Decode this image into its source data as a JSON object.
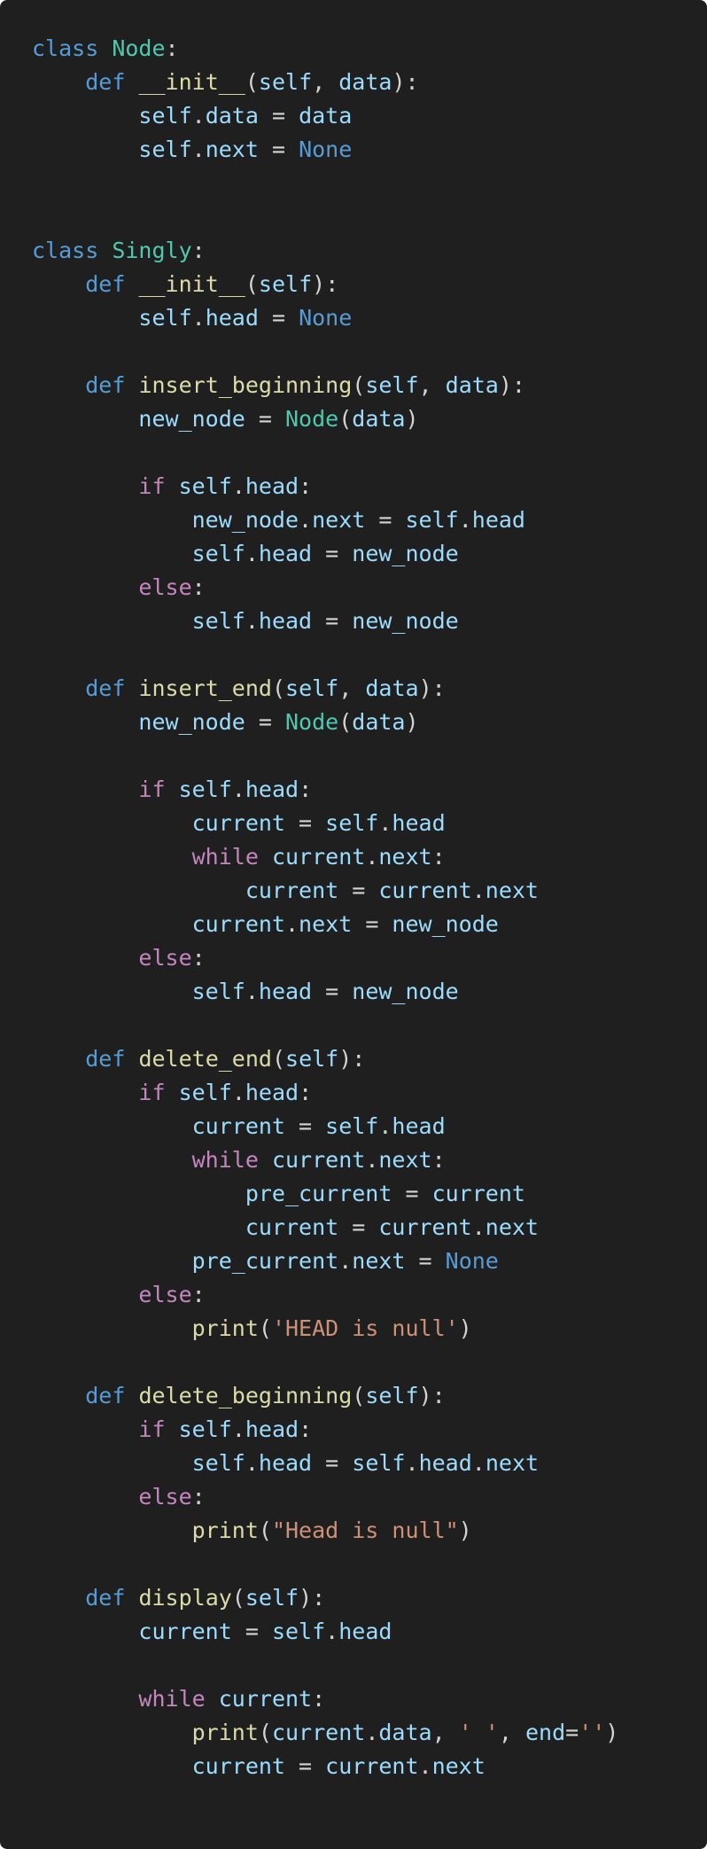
{
  "colors": {
    "background": "#1f1f1f",
    "keyword": "#569cd6",
    "control": "#c586c0",
    "class": "#4ec9b0",
    "function": "#dcdcaa",
    "variable": "#9cdcfe",
    "constant": "#569cd6",
    "string": "#ce9178",
    "punctuation": "#d4d4d4"
  },
  "code": {
    "language": "python",
    "lines": [
      [
        {
          "t": "class",
          "k": "keyword"
        },
        {
          "t": " ",
          "k": "punct"
        },
        {
          "t": "Node",
          "k": "class"
        },
        {
          "t": ":",
          "k": "punct"
        }
      ],
      [
        {
          "t": "    ",
          "k": "punct"
        },
        {
          "t": "def",
          "k": "keyword"
        },
        {
          "t": " ",
          "k": "punct"
        },
        {
          "t": "__init__",
          "k": "func"
        },
        {
          "t": "(",
          "k": "punct"
        },
        {
          "t": "self",
          "k": "var"
        },
        {
          "t": ", ",
          "k": "punct"
        },
        {
          "t": "data",
          "k": "var"
        },
        {
          "t": "):",
          "k": "punct"
        }
      ],
      [
        {
          "t": "        ",
          "k": "punct"
        },
        {
          "t": "self",
          "k": "var"
        },
        {
          "t": ".",
          "k": "punct"
        },
        {
          "t": "data",
          "k": "var"
        },
        {
          "t": " = ",
          "k": "punct"
        },
        {
          "t": "data",
          "k": "var"
        }
      ],
      [
        {
          "t": "        ",
          "k": "punct"
        },
        {
          "t": "self",
          "k": "var"
        },
        {
          "t": ".",
          "k": "punct"
        },
        {
          "t": "next",
          "k": "var"
        },
        {
          "t": " = ",
          "k": "punct"
        },
        {
          "t": "None",
          "k": "const"
        }
      ],
      [],
      [],
      [
        {
          "t": "class",
          "k": "keyword"
        },
        {
          "t": " ",
          "k": "punct"
        },
        {
          "t": "Singly",
          "k": "class"
        },
        {
          "t": ":",
          "k": "punct"
        }
      ],
      [
        {
          "t": "    ",
          "k": "punct"
        },
        {
          "t": "def",
          "k": "keyword"
        },
        {
          "t": " ",
          "k": "punct"
        },
        {
          "t": "__init__",
          "k": "func"
        },
        {
          "t": "(",
          "k": "punct"
        },
        {
          "t": "self",
          "k": "var"
        },
        {
          "t": "):",
          "k": "punct"
        }
      ],
      [
        {
          "t": "        ",
          "k": "punct"
        },
        {
          "t": "self",
          "k": "var"
        },
        {
          "t": ".",
          "k": "punct"
        },
        {
          "t": "head",
          "k": "var"
        },
        {
          "t": " = ",
          "k": "punct"
        },
        {
          "t": "None",
          "k": "const"
        }
      ],
      [],
      [
        {
          "t": "    ",
          "k": "punct"
        },
        {
          "t": "def",
          "k": "keyword"
        },
        {
          "t": " ",
          "k": "punct"
        },
        {
          "t": "insert_beginning",
          "k": "func"
        },
        {
          "t": "(",
          "k": "punct"
        },
        {
          "t": "self",
          "k": "var"
        },
        {
          "t": ", ",
          "k": "punct"
        },
        {
          "t": "data",
          "k": "var"
        },
        {
          "t": "):",
          "k": "punct"
        }
      ],
      [
        {
          "t": "        ",
          "k": "punct"
        },
        {
          "t": "new_node",
          "k": "var"
        },
        {
          "t": " = ",
          "k": "punct"
        },
        {
          "t": "Node",
          "k": "class"
        },
        {
          "t": "(",
          "k": "punct"
        },
        {
          "t": "data",
          "k": "var"
        },
        {
          "t": ")",
          "k": "punct"
        }
      ],
      [],
      [
        {
          "t": "        ",
          "k": "punct"
        },
        {
          "t": "if",
          "k": "control"
        },
        {
          "t": " ",
          "k": "punct"
        },
        {
          "t": "self",
          "k": "var"
        },
        {
          "t": ".",
          "k": "punct"
        },
        {
          "t": "head",
          "k": "var"
        },
        {
          "t": ":",
          "k": "punct"
        }
      ],
      [
        {
          "t": "            ",
          "k": "punct"
        },
        {
          "t": "new_node",
          "k": "var"
        },
        {
          "t": ".",
          "k": "punct"
        },
        {
          "t": "next",
          "k": "var"
        },
        {
          "t": " = ",
          "k": "punct"
        },
        {
          "t": "self",
          "k": "var"
        },
        {
          "t": ".",
          "k": "punct"
        },
        {
          "t": "head",
          "k": "var"
        }
      ],
      [
        {
          "t": "            ",
          "k": "punct"
        },
        {
          "t": "self",
          "k": "var"
        },
        {
          "t": ".",
          "k": "punct"
        },
        {
          "t": "head",
          "k": "var"
        },
        {
          "t": " = ",
          "k": "punct"
        },
        {
          "t": "new_node",
          "k": "var"
        }
      ],
      [
        {
          "t": "        ",
          "k": "punct"
        },
        {
          "t": "else",
          "k": "control"
        },
        {
          "t": ":",
          "k": "punct"
        }
      ],
      [
        {
          "t": "            ",
          "k": "punct"
        },
        {
          "t": "self",
          "k": "var"
        },
        {
          "t": ".",
          "k": "punct"
        },
        {
          "t": "head",
          "k": "var"
        },
        {
          "t": " = ",
          "k": "punct"
        },
        {
          "t": "new_node",
          "k": "var"
        }
      ],
      [],
      [
        {
          "t": "    ",
          "k": "punct"
        },
        {
          "t": "def",
          "k": "keyword"
        },
        {
          "t": " ",
          "k": "punct"
        },
        {
          "t": "insert_end",
          "k": "func"
        },
        {
          "t": "(",
          "k": "punct"
        },
        {
          "t": "self",
          "k": "var"
        },
        {
          "t": ", ",
          "k": "punct"
        },
        {
          "t": "data",
          "k": "var"
        },
        {
          "t": "):",
          "k": "punct"
        }
      ],
      [
        {
          "t": "        ",
          "k": "punct"
        },
        {
          "t": "new_node",
          "k": "var"
        },
        {
          "t": " = ",
          "k": "punct"
        },
        {
          "t": "Node",
          "k": "class"
        },
        {
          "t": "(",
          "k": "punct"
        },
        {
          "t": "data",
          "k": "var"
        },
        {
          "t": ")",
          "k": "punct"
        }
      ],
      [],
      [
        {
          "t": "        ",
          "k": "punct"
        },
        {
          "t": "if",
          "k": "control"
        },
        {
          "t": " ",
          "k": "punct"
        },
        {
          "t": "self",
          "k": "var"
        },
        {
          "t": ".",
          "k": "punct"
        },
        {
          "t": "head",
          "k": "var"
        },
        {
          "t": ":",
          "k": "punct"
        }
      ],
      [
        {
          "t": "            ",
          "k": "punct"
        },
        {
          "t": "current",
          "k": "var"
        },
        {
          "t": " = ",
          "k": "punct"
        },
        {
          "t": "self",
          "k": "var"
        },
        {
          "t": ".",
          "k": "punct"
        },
        {
          "t": "head",
          "k": "var"
        }
      ],
      [
        {
          "t": "            ",
          "k": "punct"
        },
        {
          "t": "while",
          "k": "control"
        },
        {
          "t": " ",
          "k": "punct"
        },
        {
          "t": "current",
          "k": "var"
        },
        {
          "t": ".",
          "k": "punct"
        },
        {
          "t": "next",
          "k": "var"
        },
        {
          "t": ":",
          "k": "punct"
        }
      ],
      [
        {
          "t": "                ",
          "k": "punct"
        },
        {
          "t": "current",
          "k": "var"
        },
        {
          "t": " = ",
          "k": "punct"
        },
        {
          "t": "current",
          "k": "var"
        },
        {
          "t": ".",
          "k": "punct"
        },
        {
          "t": "next",
          "k": "var"
        }
      ],
      [
        {
          "t": "            ",
          "k": "punct"
        },
        {
          "t": "current",
          "k": "var"
        },
        {
          "t": ".",
          "k": "punct"
        },
        {
          "t": "next",
          "k": "var"
        },
        {
          "t": " = ",
          "k": "punct"
        },
        {
          "t": "new_node",
          "k": "var"
        }
      ],
      [
        {
          "t": "        ",
          "k": "punct"
        },
        {
          "t": "else",
          "k": "control"
        },
        {
          "t": ":",
          "k": "punct"
        }
      ],
      [
        {
          "t": "            ",
          "k": "punct"
        },
        {
          "t": "self",
          "k": "var"
        },
        {
          "t": ".",
          "k": "punct"
        },
        {
          "t": "head",
          "k": "var"
        },
        {
          "t": " = ",
          "k": "punct"
        },
        {
          "t": "new_node",
          "k": "var"
        }
      ],
      [],
      [
        {
          "t": "    ",
          "k": "punct"
        },
        {
          "t": "def",
          "k": "keyword"
        },
        {
          "t": " ",
          "k": "punct"
        },
        {
          "t": "delete_end",
          "k": "func"
        },
        {
          "t": "(",
          "k": "punct"
        },
        {
          "t": "self",
          "k": "var"
        },
        {
          "t": "):",
          "k": "punct"
        }
      ],
      [
        {
          "t": "        ",
          "k": "punct"
        },
        {
          "t": "if",
          "k": "control"
        },
        {
          "t": " ",
          "k": "punct"
        },
        {
          "t": "self",
          "k": "var"
        },
        {
          "t": ".",
          "k": "punct"
        },
        {
          "t": "head",
          "k": "var"
        },
        {
          "t": ":",
          "k": "punct"
        }
      ],
      [
        {
          "t": "            ",
          "k": "punct"
        },
        {
          "t": "current",
          "k": "var"
        },
        {
          "t": " = ",
          "k": "punct"
        },
        {
          "t": "self",
          "k": "var"
        },
        {
          "t": ".",
          "k": "punct"
        },
        {
          "t": "head",
          "k": "var"
        }
      ],
      [
        {
          "t": "            ",
          "k": "punct"
        },
        {
          "t": "while",
          "k": "control"
        },
        {
          "t": " ",
          "k": "punct"
        },
        {
          "t": "current",
          "k": "var"
        },
        {
          "t": ".",
          "k": "punct"
        },
        {
          "t": "next",
          "k": "var"
        },
        {
          "t": ":",
          "k": "punct"
        }
      ],
      [
        {
          "t": "                ",
          "k": "punct"
        },
        {
          "t": "pre_current",
          "k": "var"
        },
        {
          "t": " = ",
          "k": "punct"
        },
        {
          "t": "current",
          "k": "var"
        }
      ],
      [
        {
          "t": "                ",
          "k": "punct"
        },
        {
          "t": "current",
          "k": "var"
        },
        {
          "t": " = ",
          "k": "punct"
        },
        {
          "t": "current",
          "k": "var"
        },
        {
          "t": ".",
          "k": "punct"
        },
        {
          "t": "next",
          "k": "var"
        }
      ],
      [
        {
          "t": "            ",
          "k": "punct"
        },
        {
          "t": "pre_current",
          "k": "var"
        },
        {
          "t": ".",
          "k": "punct"
        },
        {
          "t": "next",
          "k": "var"
        },
        {
          "t": " = ",
          "k": "punct"
        },
        {
          "t": "None",
          "k": "const"
        }
      ],
      [
        {
          "t": "        ",
          "k": "punct"
        },
        {
          "t": "else",
          "k": "control"
        },
        {
          "t": ":",
          "k": "punct"
        }
      ],
      [
        {
          "t": "            ",
          "k": "punct"
        },
        {
          "t": "print",
          "k": "func"
        },
        {
          "t": "(",
          "k": "punct"
        },
        {
          "t": "'HEAD is null'",
          "k": "string"
        },
        {
          "t": ")",
          "k": "punct"
        }
      ],
      [],
      [
        {
          "t": "    ",
          "k": "punct"
        },
        {
          "t": "def",
          "k": "keyword"
        },
        {
          "t": " ",
          "k": "punct"
        },
        {
          "t": "delete_beginning",
          "k": "func"
        },
        {
          "t": "(",
          "k": "punct"
        },
        {
          "t": "self",
          "k": "var"
        },
        {
          "t": "):",
          "k": "punct"
        }
      ],
      [
        {
          "t": "        ",
          "k": "punct"
        },
        {
          "t": "if",
          "k": "control"
        },
        {
          "t": " ",
          "k": "punct"
        },
        {
          "t": "self",
          "k": "var"
        },
        {
          "t": ".",
          "k": "punct"
        },
        {
          "t": "head",
          "k": "var"
        },
        {
          "t": ":",
          "k": "punct"
        }
      ],
      [
        {
          "t": "            ",
          "k": "punct"
        },
        {
          "t": "self",
          "k": "var"
        },
        {
          "t": ".",
          "k": "punct"
        },
        {
          "t": "head",
          "k": "var"
        },
        {
          "t": " = ",
          "k": "punct"
        },
        {
          "t": "self",
          "k": "var"
        },
        {
          "t": ".",
          "k": "punct"
        },
        {
          "t": "head",
          "k": "var"
        },
        {
          "t": ".",
          "k": "punct"
        },
        {
          "t": "next",
          "k": "var"
        }
      ],
      [
        {
          "t": "        ",
          "k": "punct"
        },
        {
          "t": "else",
          "k": "control"
        },
        {
          "t": ":",
          "k": "punct"
        }
      ],
      [
        {
          "t": "            ",
          "k": "punct"
        },
        {
          "t": "print",
          "k": "func"
        },
        {
          "t": "(",
          "k": "punct"
        },
        {
          "t": "\"Head is null\"",
          "k": "string"
        },
        {
          "t": ")",
          "k": "punct"
        }
      ],
      [],
      [
        {
          "t": "    ",
          "k": "punct"
        },
        {
          "t": "def",
          "k": "keyword"
        },
        {
          "t": " ",
          "k": "punct"
        },
        {
          "t": "display",
          "k": "func"
        },
        {
          "t": "(",
          "k": "punct"
        },
        {
          "t": "self",
          "k": "var"
        },
        {
          "t": "):",
          "k": "punct"
        }
      ],
      [
        {
          "t": "        ",
          "k": "punct"
        },
        {
          "t": "current",
          "k": "var"
        },
        {
          "t": " = ",
          "k": "punct"
        },
        {
          "t": "self",
          "k": "var"
        },
        {
          "t": ".",
          "k": "punct"
        },
        {
          "t": "head",
          "k": "var"
        }
      ],
      [],
      [
        {
          "t": "        ",
          "k": "punct"
        },
        {
          "t": "while",
          "k": "control"
        },
        {
          "t": " ",
          "k": "punct"
        },
        {
          "t": "current",
          "k": "var"
        },
        {
          "t": ":",
          "k": "punct"
        }
      ],
      [
        {
          "t": "            ",
          "k": "punct"
        },
        {
          "t": "print",
          "k": "func"
        },
        {
          "t": "(",
          "k": "punct"
        },
        {
          "t": "current",
          "k": "var"
        },
        {
          "t": ".",
          "k": "punct"
        },
        {
          "t": "data",
          "k": "var"
        },
        {
          "t": ", ",
          "k": "punct"
        },
        {
          "t": "' '",
          "k": "string"
        },
        {
          "t": ", ",
          "k": "punct"
        },
        {
          "t": "end",
          "k": "var"
        },
        {
          "t": "=",
          "k": "punct"
        },
        {
          "t": "''",
          "k": "string"
        },
        {
          "t": ")",
          "k": "punct"
        }
      ],
      [
        {
          "t": "            ",
          "k": "punct"
        },
        {
          "t": "current",
          "k": "var"
        },
        {
          "t": " = ",
          "k": "punct"
        },
        {
          "t": "current",
          "k": "var"
        },
        {
          "t": ".",
          "k": "punct"
        },
        {
          "t": "next",
          "k": "var"
        }
      ]
    ]
  }
}
